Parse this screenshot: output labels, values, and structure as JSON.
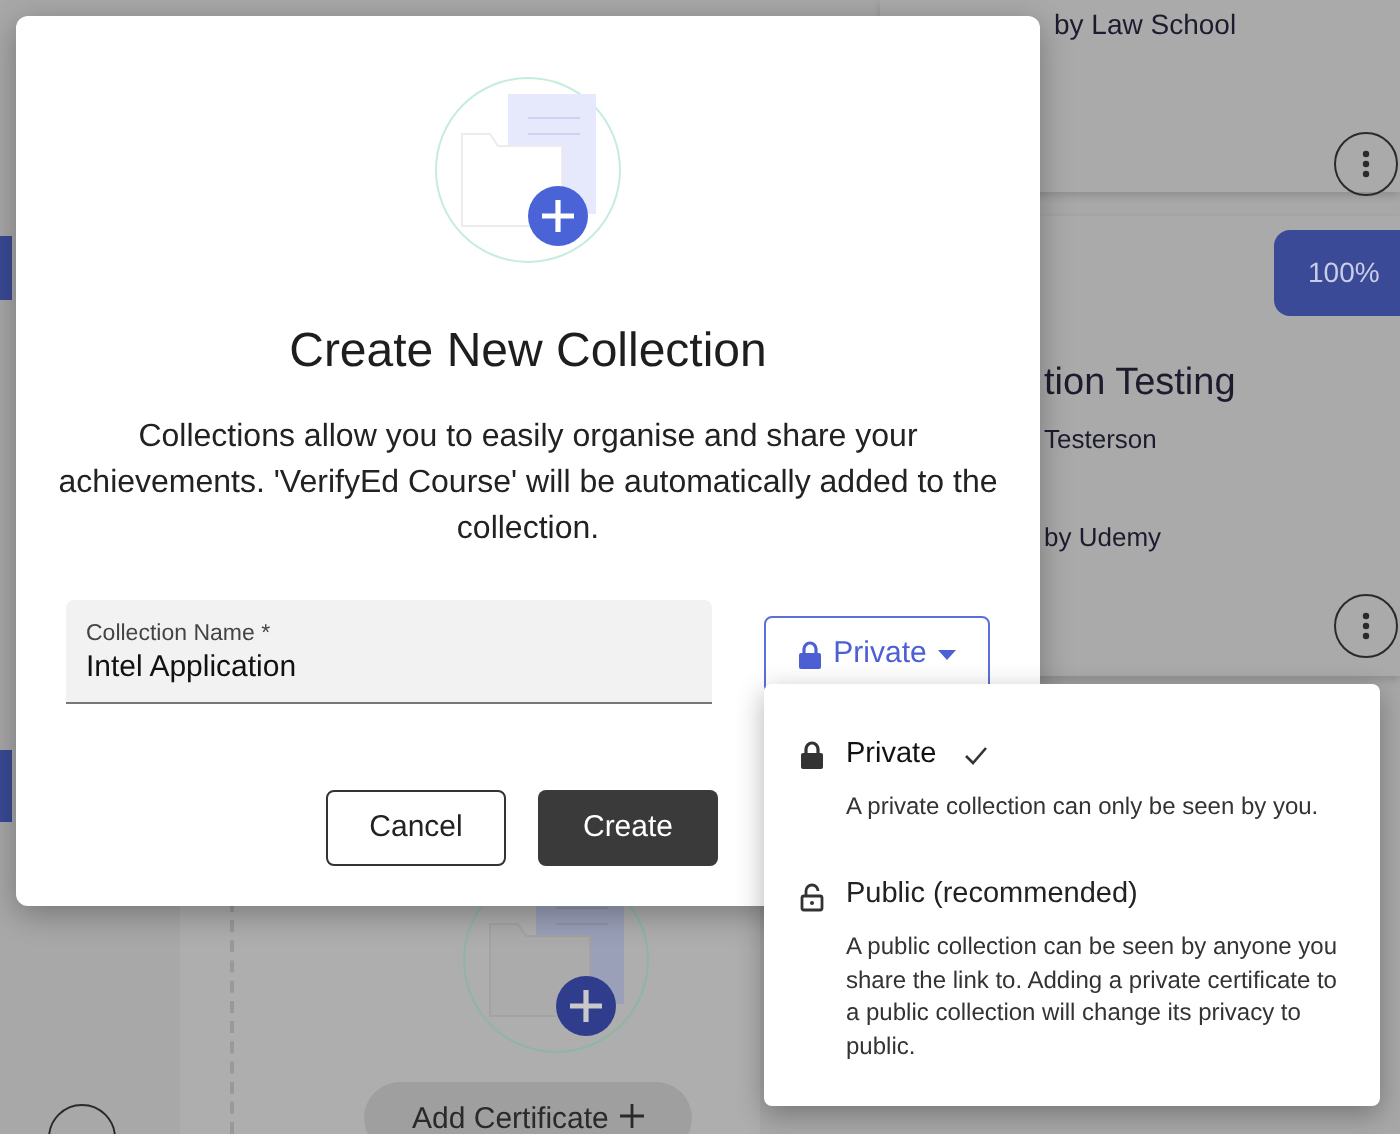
{
  "background": {
    "top_card": {
      "issuer": "by Law School"
    },
    "course_card": {
      "progress_badge": "100%",
      "title": "tion Testing",
      "recipient": "Testerson",
      "issuer": "by Udemy"
    },
    "add_certificate_button": {
      "label": "Add Certificate"
    }
  },
  "dialog": {
    "title": "Create New Collection",
    "description": "Collections allow you to easily organise and share your achievements. 'VerifyEd Course' will be automatically added to the collection.",
    "name_field": {
      "label": "Collection Name *",
      "value": "Intel Application"
    },
    "privacy_button": {
      "label": "Private"
    },
    "buttons": [
      {
        "label": "Cancel",
        "kind": "secondary"
      },
      {
        "label": "Create",
        "kind": "primary"
      }
    ]
  },
  "privacy_menu": {
    "options": [
      {
        "kind": "locked",
        "label": "Private",
        "description": "A private collection can only be seen by you.",
        "selected": true
      },
      {
        "kind": "unlocked",
        "label": "Public (recommended)",
        "description": "A public collection can be seen by anyone you share the link to. Adding a private certificate to a public collection will change its privacy to public.",
        "selected": false
      }
    ]
  }
}
